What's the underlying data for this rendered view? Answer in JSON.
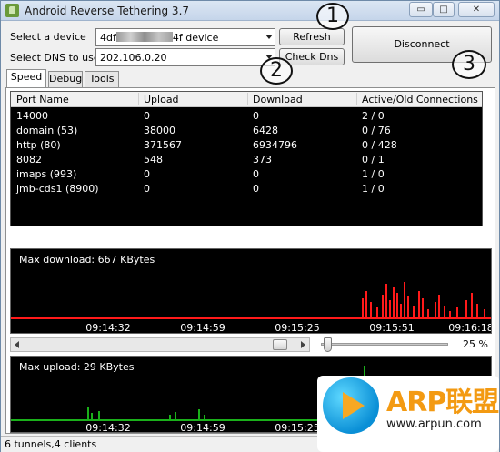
{
  "window": {
    "title": "Android Reverse Tethering 3.7",
    "controls": {
      "minimize": "▭",
      "maximize": "□",
      "close": "✕"
    }
  },
  "device": {
    "label": "Select a device",
    "value_prefix": "4df",
    "value_suffix": "4f  device",
    "refresh_label": "Refresh"
  },
  "dns": {
    "label": "Select DNS to use",
    "value": "202.106.0.20",
    "check_label": "Check Dns"
  },
  "disconnect_label": "Disconnect",
  "callouts": [
    "1",
    "2",
    "3"
  ],
  "tabs": [
    {
      "label": "Speed",
      "active": true
    },
    {
      "label": "Debug",
      "active": false
    },
    {
      "label": "Tools",
      "active": false
    }
  ],
  "table": {
    "columns": [
      "Port Name",
      "Upload",
      "Download",
      "Active/Old Connections"
    ],
    "rows": [
      [
        "14000",
        "0",
        "0",
        "2 / 0"
      ],
      [
        "domain (53)",
        "38000",
        "6428",
        "0 / 76"
      ],
      [
        "http (80)",
        "371567",
        "6934796",
        "0 / 428"
      ],
      [
        "8082",
        "548",
        "373",
        "0 / 1"
      ],
      [
        "imaps (993)",
        "0",
        "0",
        "1 / 0"
      ],
      [
        "jmb-cds1 (8900)",
        "0",
        "0",
        "1 / 0"
      ]
    ]
  },
  "download_chart": {
    "title": "Max download: 667 KBytes",
    "times": [
      "09:14:32",
      "09:14:59",
      "09:15:25",
      "09:15:51",
      "09:16:18"
    ],
    "color": "#ff1a1a"
  },
  "zoom": {
    "value": "25 %",
    "level": 0.02
  },
  "upload_chart": {
    "title": "Max upload: 29 KBytes",
    "times": [
      "09:14:32",
      "09:14:59",
      "09:15:25"
    ],
    "color": "#1ab01a"
  },
  "status": "6 tunnels,4 clients",
  "watermark": {
    "brand": "ARP联盟",
    "url": "www.arpun.com"
  }
}
